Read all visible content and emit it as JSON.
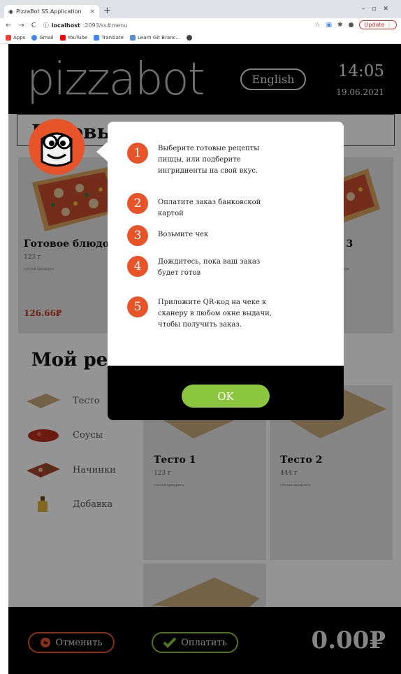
{
  "browser": {
    "tab_title": "PizzaBot SS Application",
    "tab_close": "×",
    "new_tab": "+",
    "url_host": "localhost",
    "url_path": ":2093/ss#menu",
    "update_label": "Update",
    "bookmarks": [
      "Apps",
      "Gmail",
      "YouTube",
      "Translate",
      "Learn Git Branc..."
    ]
  },
  "header": {
    "logo": "pizzabot",
    "language": "English",
    "time": "14:05",
    "date": "19.06.2021"
  },
  "ready_section": {
    "title": "Готовый",
    "cards": [
      {
        "name": "Готовое блюдо 1",
        "weight": "123 г",
        "composition": "состав продукта",
        "price": "126.66₽"
      },
      {
        "name": "до 3",
        "weight": "",
        "composition": "нта,состав\nтав",
        "price": ""
      }
    ]
  },
  "my_recipe": {
    "title": "Мой рецеп",
    "categories": [
      "Тесто",
      "Соусы",
      "Начинки",
      "Добавка"
    ],
    "cards": [
      {
        "name": "Тесто 1",
        "weight": "123 г",
        "composition": "состав продукта"
      },
      {
        "name": "Тесто 2",
        "weight": "444 г",
        "composition": "состав продукта"
      }
    ]
  },
  "modal": {
    "steps": [
      {
        "num": "1",
        "text": "Выберите готовые рецепты пиццы, или подберите ингридиенты на свой вкус."
      },
      {
        "num": "2",
        "text": "Оплатите заказ банковской картой"
      },
      {
        "num": "3",
        "text": "Возьмите чек"
      },
      {
        "num": "4",
        "text": "Дождитесь, пока ваш заказ будет готов"
      },
      {
        "num": "5",
        "text": "Приложите QR-код на чеке к сканеру в любом окне выдачи, чтобы получить заказ."
      }
    ],
    "ok_label": "OK"
  },
  "footer": {
    "cancel_label": "Отменить",
    "pay_label": "Оплатить",
    "total": "0.00₽"
  },
  "colors": {
    "accent_orange": "#e8542a",
    "accent_green": "#8cc63f",
    "header_bg": "#000000"
  }
}
